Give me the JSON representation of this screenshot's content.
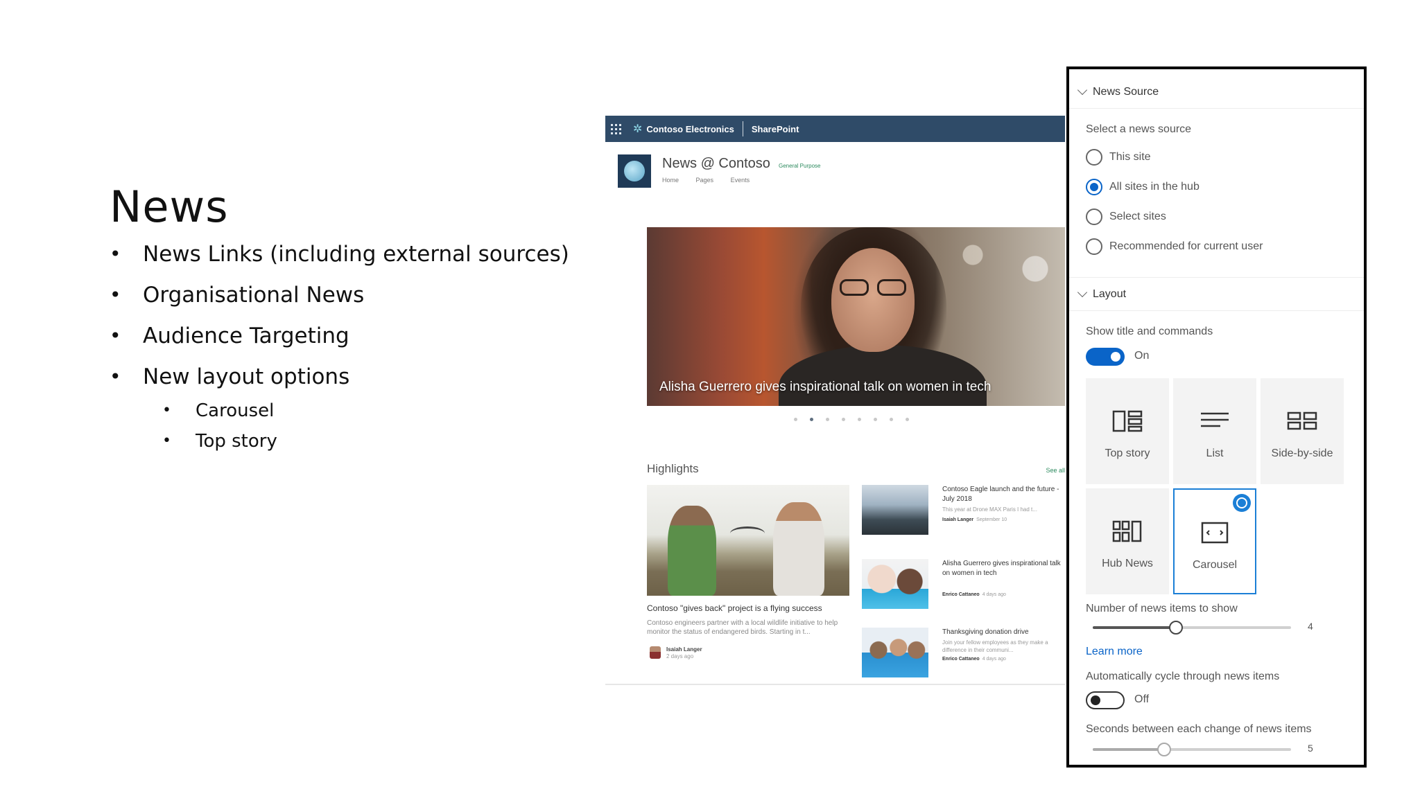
{
  "slide": {
    "title": "News",
    "bullets": [
      "News Links (including external sources)",
      "Organisational News",
      "Audience Targeting",
      "New layout options"
    ],
    "sub_bullets": [
      "Carousel",
      "Top story"
    ]
  },
  "sharepoint": {
    "suite_bar": {
      "org": "Contoso Electronics",
      "app": "SharePoint"
    },
    "site": {
      "title": "News @ Contoso",
      "tag": "General Purpose",
      "nav": [
        "Home",
        "Pages",
        "Events"
      ]
    },
    "hero": {
      "caption": "Alisha Guerrero gives inspirational talk on women in tech"
    },
    "highlights": {
      "title": "Highlights",
      "see_all": "See all",
      "main": {
        "title": "Contoso \"gives back\" project is a flying success",
        "desc": "Contoso engineers partner with a local wildlife initiative to help monitor the status of endangered birds. Starting in t...",
        "author": "Isaiah Langer",
        "date": "2 days ago"
      },
      "items": [
        {
          "title": "Contoso Eagle launch and the future - July 2018",
          "desc": "This year at Drone MAX Paris I had t...",
          "author": "Isaiah Langer",
          "date": "September 10"
        },
        {
          "title": "Alisha Guerrero gives inspirational talk on women in tech",
          "desc": "",
          "author": "Enrico Cattaneo",
          "date": "4 days ago"
        },
        {
          "title": "Thanksgiving donation drive",
          "desc": "Join your fellow employees as they make a difference in their communi...",
          "author": "Enrico Cattaneo",
          "date": "4 days ago"
        }
      ]
    }
  },
  "pane": {
    "news_source": {
      "header": "News Source",
      "select_label": "Select a news source",
      "options": [
        "This site",
        "All sites in the hub",
        "Select sites",
        "Recommended for current user"
      ],
      "selected": "All sites in the hub"
    },
    "layout": {
      "header": "Layout",
      "show_title_label": "Show title and commands",
      "show_title_state": "On",
      "tiles": [
        "Top story",
        "List",
        "Side-by-side",
        "Hub News",
        "Carousel"
      ],
      "selected_tile": "Carousel",
      "num_items_label": "Number of news items to show",
      "num_items_value": "4",
      "num_items_fraction": 0.42,
      "learn_more": "Learn more",
      "auto_cycle_label": "Automatically cycle through news items",
      "auto_cycle_state": "Off",
      "seconds_label": "Seconds between each change of news items",
      "seconds_value": "5",
      "seconds_fraction": 0.36
    }
  },
  "colors": {
    "suite_bar": "#2f4b68",
    "accent": "#0a64c8",
    "tile_select": "#1b7fd6"
  }
}
